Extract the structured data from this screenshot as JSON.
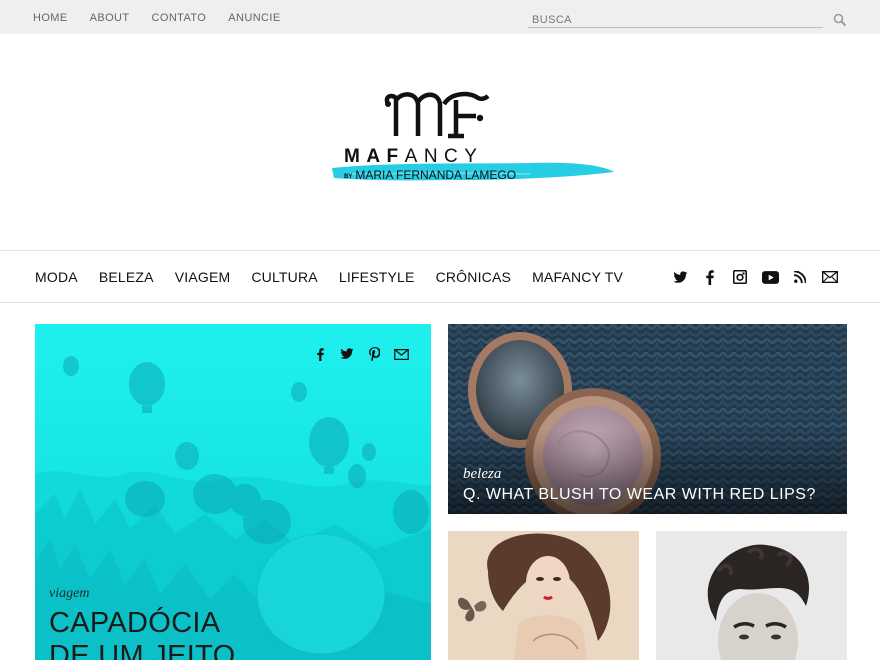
{
  "topbar": {
    "links": [
      "HOME",
      "ABOUT",
      "CONTATO",
      "ANUNCIE"
    ],
    "search_placeholder": "BUSCA"
  },
  "logo": {
    "monogram": "MF",
    "wordmark_bold": "MAF",
    "wordmark_light": "ANCY",
    "byline_prefix": "BY",
    "byline": "MARIA FERNANDA LAMEGO",
    "brush_color": "#27cde3"
  },
  "nav": {
    "categories": [
      "MODA",
      "BELEZA",
      "VIAGEM",
      "CULTURA",
      "LIFESTYLE",
      "CRÔNICAS",
      "MAFANCY TV"
    ],
    "social_icons": [
      "twitter-icon",
      "facebook-icon",
      "instagram-icon",
      "youtube-icon",
      "rss-icon",
      "mail-icon"
    ]
  },
  "posts": {
    "featured": {
      "category": "viagem",
      "title_line1": "CAPADÓCIA",
      "title_line2": "DE UM JEITO",
      "overlay_color": "#14e6e8",
      "share_icons": [
        "facebook-icon",
        "twitter-icon",
        "pinterest-icon",
        "mail-icon"
      ]
    },
    "blush": {
      "category": "beleza",
      "title": "Q. WHAT BLUSH TO WEAR WITH RED LIPS?"
    }
  },
  "colors": {
    "topbar_bg": "#efefef",
    "text": "#111111",
    "muted": "#666666"
  }
}
